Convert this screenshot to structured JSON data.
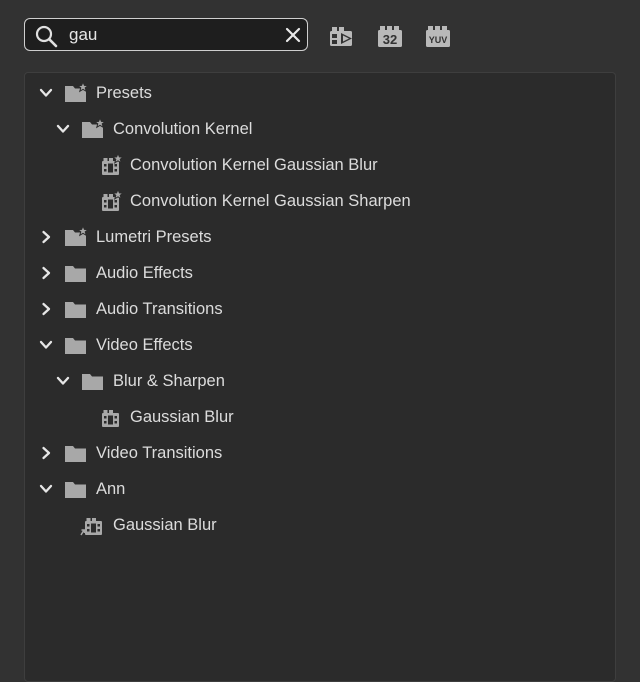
{
  "search": {
    "value": "gau",
    "placeholder": ""
  },
  "toolbar": {
    "accelerated_icon": "accelerated-effects-icon",
    "bit32_label": "32",
    "yuv_label": "YUV"
  },
  "tree": [
    {
      "id": "presets",
      "label": "Presets",
      "level": 0,
      "icon": "preset-folder-icon",
      "expanded": true,
      "has_children": true
    },
    {
      "id": "convolution-kernel",
      "label": "Convolution Kernel",
      "level": 1,
      "icon": "preset-folder-icon",
      "expanded": true,
      "has_children": true
    },
    {
      "id": "ck-gaussian-blur",
      "label": "Convolution Kernel Gaussian Blur",
      "level": 2,
      "icon": "preset-effect-icon",
      "has_children": false
    },
    {
      "id": "ck-gaussian-sharpen",
      "label": "Convolution Kernel Gaussian Sharpen",
      "level": 2,
      "icon": "preset-effect-icon",
      "has_children": false
    },
    {
      "id": "lumetri-presets",
      "label": "Lumetri Presets",
      "level": 0,
      "icon": "preset-folder-icon",
      "expanded": false,
      "has_children": true
    },
    {
      "id": "audio-effects",
      "label": "Audio Effects",
      "level": 0,
      "icon": "folder-icon",
      "expanded": false,
      "has_children": true
    },
    {
      "id": "audio-transitions",
      "label": "Audio Transitions",
      "level": 0,
      "icon": "folder-icon",
      "expanded": false,
      "has_children": true
    },
    {
      "id": "video-effects",
      "label": "Video Effects",
      "level": 0,
      "icon": "folder-icon",
      "expanded": true,
      "has_children": true
    },
    {
      "id": "blur-sharpen",
      "label": "Blur & Sharpen",
      "level": 1,
      "icon": "folder-icon",
      "expanded": true,
      "has_children": true
    },
    {
      "id": "gaussian-blur",
      "label": "Gaussian Blur",
      "level": 2,
      "icon": "effect-icon",
      "has_children": false
    },
    {
      "id": "video-transitions",
      "label": "Video Transitions",
      "level": 0,
      "icon": "folder-icon",
      "expanded": false,
      "has_children": true
    },
    {
      "id": "ann",
      "label": "Ann",
      "level": 0,
      "icon": "folder-icon",
      "expanded": true,
      "has_children": true
    },
    {
      "id": "ann-gaussian-blur",
      "label": "Gaussian Blur",
      "level": 1,
      "icon": "effect-shortcut-icon",
      "has_children": false
    }
  ]
}
